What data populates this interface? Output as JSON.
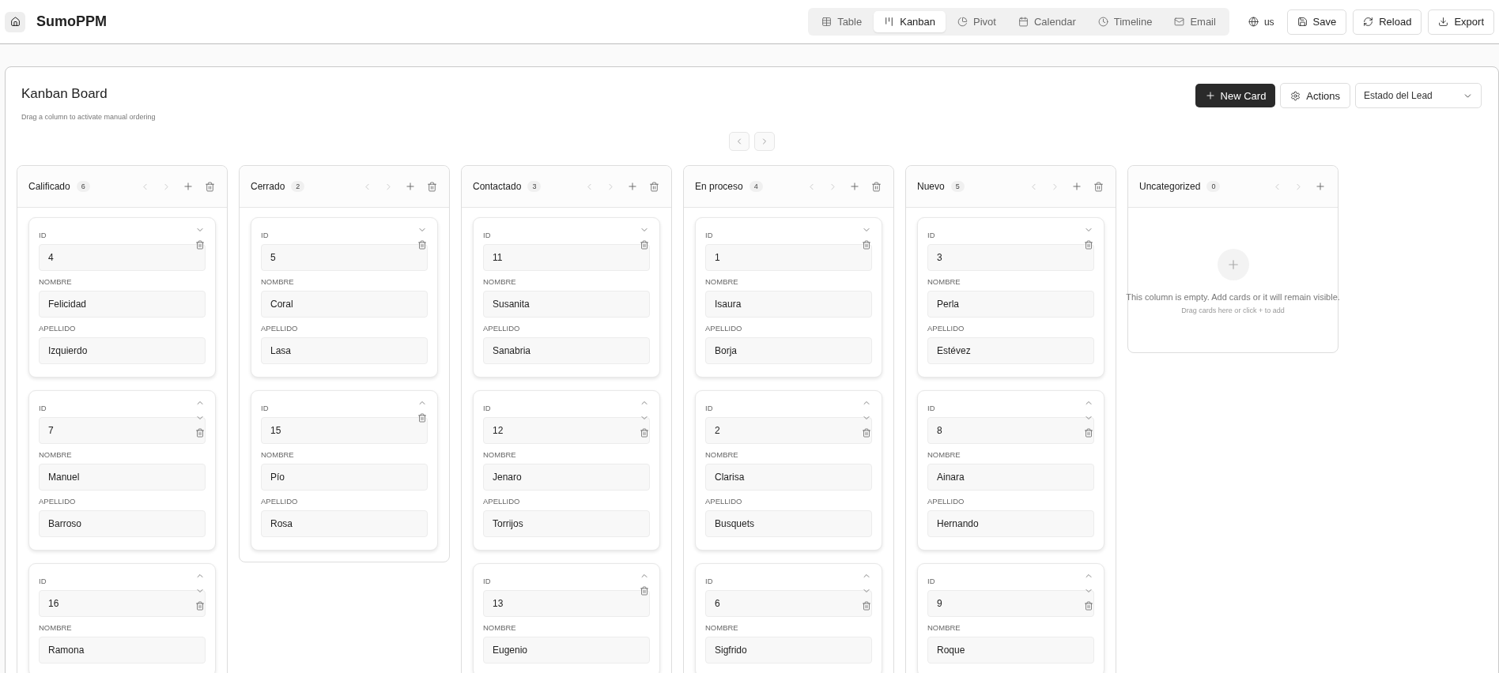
{
  "app": {
    "name": "SumoPPM"
  },
  "view_tabs": [
    {
      "kind": "table",
      "label": "Table",
      "selected": false
    },
    {
      "kind": "kanban",
      "label": "Kanban",
      "selected": true
    },
    {
      "kind": "pivot",
      "label": "Pivot",
      "selected": false
    },
    {
      "kind": "calendar",
      "label": "Calendar",
      "selected": false
    },
    {
      "kind": "timeline",
      "label": "Timeline",
      "selected": false
    },
    {
      "kind": "email",
      "label": "Email",
      "selected": false
    }
  ],
  "language": "us",
  "toolbar_buttons": [
    {
      "kind": "save",
      "label": "Save"
    },
    {
      "kind": "reload",
      "label": "Reload"
    },
    {
      "kind": "export",
      "label": "Export"
    }
  ],
  "board": {
    "title": "Kanban Board",
    "subtitle": "Drag a column to activate manual ordering",
    "new_card_button": "New Card",
    "actions_button": "Actions",
    "group_by": "Estado del Lead"
  },
  "columns": [
    {
      "name": "Calificado",
      "count": "6",
      "deletable": true,
      "cards": [
        {
          "can_move_up": false,
          "can_move_down": true,
          "fields": [
            {
              "label": "ID",
              "value": "4"
            },
            {
              "label": "NOMBRE",
              "value": "Felicidad"
            },
            {
              "label": "APELLIDO",
              "value": "Izquierdo"
            }
          ]
        },
        {
          "can_move_up": true,
          "can_move_down": true,
          "fields": [
            {
              "label": "ID",
              "value": "7"
            },
            {
              "label": "NOMBRE",
              "value": "Manuel"
            },
            {
              "label": "APELLIDO",
              "value": "Barroso"
            }
          ]
        },
        {
          "can_move_up": true,
          "can_move_down": true,
          "fields": [
            {
              "label": "ID",
              "value": "16"
            },
            {
              "label": "NOMBRE",
              "value": "Ramona"
            }
          ]
        }
      ]
    },
    {
      "name": "Cerrado",
      "count": "2",
      "deletable": true,
      "cards": [
        {
          "can_move_up": false,
          "can_move_down": true,
          "fields": [
            {
              "label": "ID",
              "value": "5"
            },
            {
              "label": "NOMBRE",
              "value": "Coral"
            },
            {
              "label": "APELLIDO",
              "value": "Lasa"
            }
          ]
        },
        {
          "can_move_up": true,
          "can_move_down": false,
          "fields": [
            {
              "label": "ID",
              "value": "15"
            },
            {
              "label": "NOMBRE",
              "value": "Pío"
            },
            {
              "label": "APELLIDO",
              "value": "Rosa"
            }
          ]
        }
      ]
    },
    {
      "name": "Contactado",
      "count": "3",
      "deletable": true,
      "cards": [
        {
          "can_move_up": false,
          "can_move_down": true,
          "fields": [
            {
              "label": "ID",
              "value": "11"
            },
            {
              "label": "NOMBRE",
              "value": "Susanita"
            },
            {
              "label": "APELLIDO",
              "value": "Sanabria"
            }
          ]
        },
        {
          "can_move_up": true,
          "can_move_down": true,
          "fields": [
            {
              "label": "ID",
              "value": "12"
            },
            {
              "label": "NOMBRE",
              "value": "Jenaro"
            },
            {
              "label": "APELLIDO",
              "value": "Torrijos"
            }
          ]
        },
        {
          "can_move_up": true,
          "can_move_down": false,
          "fields": [
            {
              "label": "ID",
              "value": "13"
            },
            {
              "label": "NOMBRE",
              "value": "Eugenio"
            }
          ]
        }
      ]
    },
    {
      "name": "En proceso",
      "count": "4",
      "deletable": true,
      "cards": [
        {
          "can_move_up": false,
          "can_move_down": true,
          "fields": [
            {
              "label": "ID",
              "value": "1"
            },
            {
              "label": "NOMBRE",
              "value": "Isaura"
            },
            {
              "label": "APELLIDO",
              "value": "Borja"
            }
          ]
        },
        {
          "can_move_up": true,
          "can_move_down": true,
          "fields": [
            {
              "label": "ID",
              "value": "2"
            },
            {
              "label": "NOMBRE",
              "value": "Clarisa"
            },
            {
              "label": "APELLIDO",
              "value": "Busquets"
            }
          ]
        },
        {
          "can_move_up": true,
          "can_move_down": true,
          "fields": [
            {
              "label": "ID",
              "value": "6"
            },
            {
              "label": "NOMBRE",
              "value": "Sigfrido"
            }
          ]
        }
      ]
    },
    {
      "name": "Nuevo",
      "count": "5",
      "deletable": true,
      "cards": [
        {
          "can_move_up": false,
          "can_move_down": true,
          "fields": [
            {
              "label": "ID",
              "value": "3"
            },
            {
              "label": "NOMBRE",
              "value": "Perla"
            },
            {
              "label": "APELLIDO",
              "value": "Estévez"
            }
          ]
        },
        {
          "can_move_up": true,
          "can_move_down": true,
          "fields": [
            {
              "label": "ID",
              "value": "8"
            },
            {
              "label": "NOMBRE",
              "value": "Ainara"
            },
            {
              "label": "APELLIDO",
              "value": "Hernando"
            }
          ]
        },
        {
          "can_move_up": true,
          "can_move_down": true,
          "fields": [
            {
              "label": "ID",
              "value": "9"
            },
            {
              "label": "NOMBRE",
              "value": "Roque"
            }
          ]
        }
      ]
    },
    {
      "name": "Uncategorized",
      "count": "0",
      "deletable": false,
      "empty_message": "This column is empty. Add cards or it will remain visible.",
      "empty_hint": "Drag cards here or click + to add"
    }
  ]
}
